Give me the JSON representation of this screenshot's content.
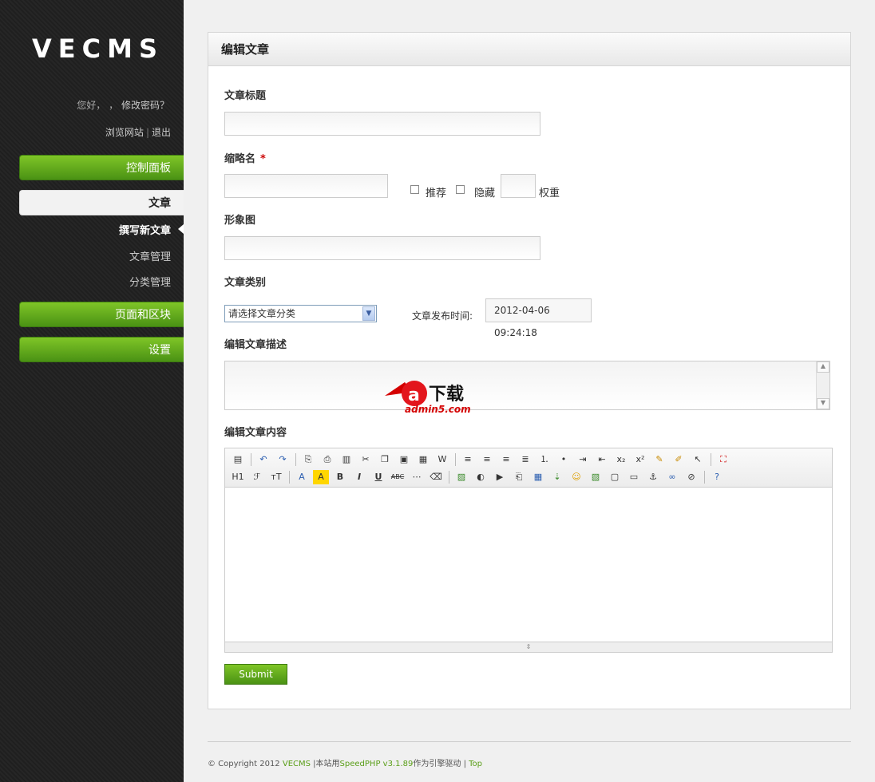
{
  "sidebar": {
    "logo": "VECMS",
    "greeting": "您好，",
    "greeting_sep": "，",
    "change_password": "修改密码？",
    "browse_site": "浏览网站",
    "logout": "退出",
    "nav": [
      {
        "label": "控制面板"
      },
      {
        "label": "文章"
      },
      {
        "label": "页面和区块"
      },
      {
        "label": "设置"
      }
    ],
    "sub": [
      {
        "label": "撰写新文章"
      },
      {
        "label": "文章管理"
      },
      {
        "label": "分类管理"
      }
    ]
  },
  "panel": {
    "title": "编辑文章",
    "fields": {
      "title_label": "文章标题",
      "slug_label": "缩略名",
      "required_mark": "*",
      "recommend": "推荐",
      "hide": "隐藏",
      "weight": "权重",
      "image_label": "形象图",
      "category_label": "文章类别",
      "category_selected": "请选择文章分类",
      "pubtime_label": "文章发布时间:",
      "pubtime_value": "2012-04-06 09:24:18",
      "desc_label": "编辑文章描述",
      "content_label": "编辑文章内容"
    },
    "submit": "Submit"
  },
  "footer": {
    "copyright": "© Copyright 2012",
    "vecms": "VECMS",
    "pipe1": "|",
    "powered": "本站用",
    "speedphp": "SpeedPHP v3.1.89",
    "engine": "作为引擎驱动",
    "pipe2": "|",
    "top": "Top"
  },
  "watermark": {
    "brand": "下载",
    "site": "admin5.com"
  }
}
